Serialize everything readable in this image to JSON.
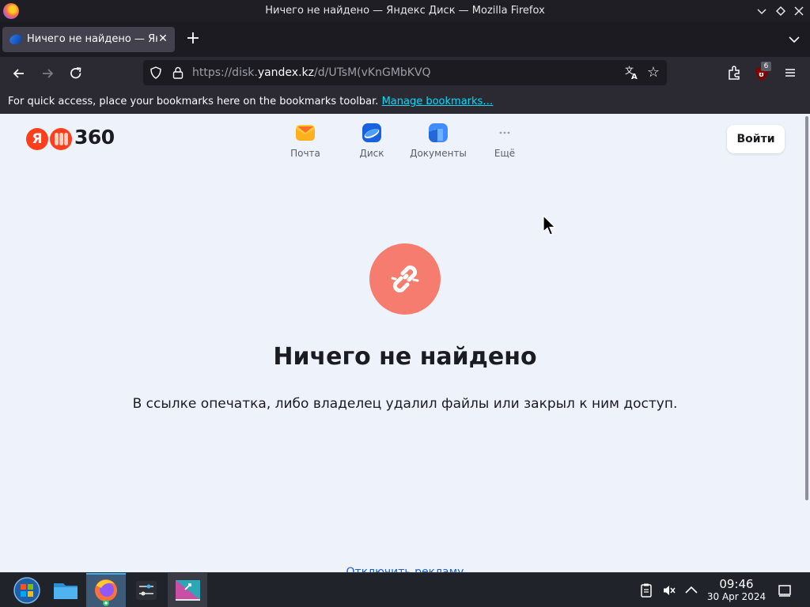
{
  "window": {
    "title": "Ничего не найдено — Яндекс Диск — Mozilla Firefox"
  },
  "tabs": [
    {
      "label": "Ничего не найдено — Яндекс Диск",
      "active": true
    }
  ],
  "urlbar": {
    "scheme": "https://disk.",
    "host": "yandex.kz",
    "path": "/d/UTsM(vKnGMbKVQ"
  },
  "extensions": {
    "ublock_badge": "6"
  },
  "bookmarks_bar": {
    "message": "For quick access, place your bookmarks here on the bookmarks toolbar.",
    "link": "Manage bookmarks…"
  },
  "header": {
    "logo_ya": "Я",
    "logo_360": "360",
    "services": [
      {
        "label": "Почта",
        "icon": "mail-icon"
      },
      {
        "label": "Диск",
        "icon": "disk-icon"
      },
      {
        "label": "Документы",
        "icon": "documents-icon"
      },
      {
        "label": "Ещё",
        "icon": "more-icon"
      }
    ],
    "login_label": "Войти"
  },
  "error": {
    "icon": "broken-link-icon",
    "title": "Ничего не найдено",
    "description": "В ссылке опечатка, либо владелец удалил файлы или закрыл к ним доступ."
  },
  "footer": {
    "link": "Отключить рекламу"
  },
  "taskbar": {
    "time": "09:46",
    "date": "30 Apr 2024"
  },
  "colors": {
    "page_bg": "#eef2fa",
    "error_circle": "#f57c6e",
    "yandex_red": "#fc3f1d",
    "link": "#00ddff"
  }
}
